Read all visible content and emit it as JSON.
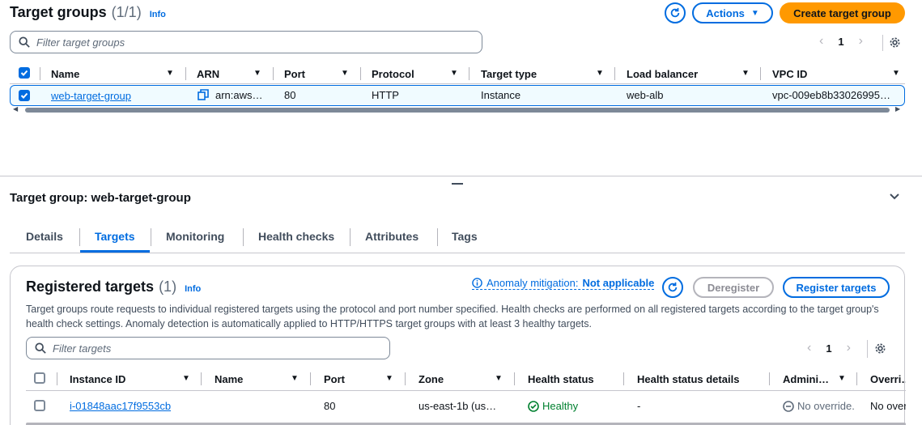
{
  "top": {
    "title": "Target groups",
    "count": "(1/1)",
    "info": "Info",
    "actions_label": "Actions",
    "create_label": "Create target group",
    "search_placeholder": "Filter target groups",
    "page": "1",
    "columns": [
      "Name",
      "ARN",
      "Port",
      "Protocol",
      "Target type",
      "Load balancer",
      "VPC ID"
    ],
    "rows": [
      {
        "name": "web-target-group",
        "arn": "arn:aws…",
        "port": "80",
        "protocol": "HTTP",
        "target_type": "Instance",
        "load_balancer": "web-alb",
        "vpc_id": "vpc-009eb8b33026995…"
      }
    ]
  },
  "detail": {
    "title": "Target group: web-target-group",
    "tabs": [
      "Details",
      "Targets",
      "Monitoring",
      "Health checks",
      "Attributes",
      "Tags"
    ],
    "active_tab": "Targets"
  },
  "registered": {
    "title": "Registered targets",
    "count": "(1)",
    "info": "Info",
    "anomaly_label": "Anomaly mitigation:",
    "anomaly_value": "Not applicable",
    "deregister_label": "Deregister",
    "register_label": "Register targets",
    "description": "Target groups route requests to individual registered targets using the protocol and port number specified. Health checks are performed on all registered targets according to the target group's health check settings. Anomaly detection is automatically applied to HTTP/HTTPS target groups with at least 3 healthy targets.",
    "search_placeholder": "Filter targets",
    "page": "1",
    "columns": [
      "Instance ID",
      "Name",
      "Port",
      "Zone",
      "Health status",
      "Health status details",
      "Admini…",
      "Overri…"
    ],
    "rows": [
      {
        "instance_id": "i-01848aac17f9553cb",
        "name": "",
        "port": "80",
        "zone": "us-east-1b (us…",
        "health": "Healthy",
        "health_details": "-",
        "admin": "No override.",
        "override": "No over"
      }
    ]
  },
  "colors": {
    "accent": "#006ce0",
    "primary": "#ff9900",
    "healthy": "#00802f",
    "selected_row": "#f0fbff"
  }
}
